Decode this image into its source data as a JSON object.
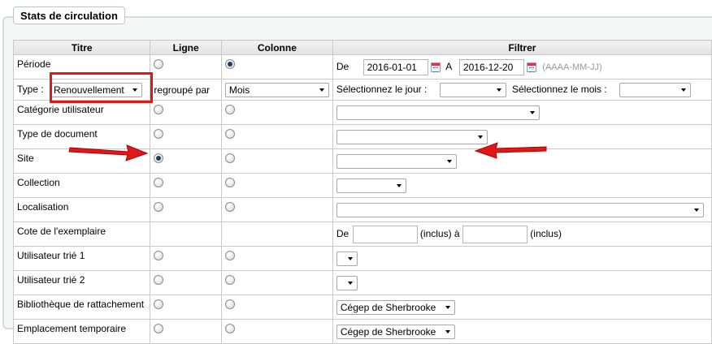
{
  "panel": {
    "title": "Stats de circulation"
  },
  "headers": {
    "titre": "Titre",
    "ligne": "Ligne",
    "colonne": "Colonne",
    "filtrer": "Filtrer"
  },
  "periode": {
    "label": "Période",
    "de_label": "De",
    "de_value": "2016-01-01",
    "a_label": "A",
    "a_value": "2016-12-20",
    "format_hint": "(AAAA-MM-JJ)"
  },
  "type_row": {
    "label": "Type :",
    "type_value": "Renouvellement",
    "grouped_label": "regroupé par",
    "group_value": "Mois",
    "day_label": "Sélectionnez le jour :",
    "month_label": "Sélectionnez le mois :"
  },
  "rows": [
    {
      "label": "Catégorie utilisateur"
    },
    {
      "label": "Type de document"
    },
    {
      "label": "Site"
    },
    {
      "label": "Collection"
    },
    {
      "label": "Localisation"
    },
    {
      "label": "Cote de l'exemplaire",
      "de_label": "De",
      "inclus_a": "(inclus) à",
      "inclus": "(inclus)"
    },
    {
      "label": "Utilisateur trié 1"
    },
    {
      "label": "Utilisateur trié 2"
    },
    {
      "label": "Bibliothèque de rattachement",
      "value": "Cégep de Sherbrooke"
    },
    {
      "label": "Emplacement temporaire",
      "value": "Cégep de Sherbrooke"
    }
  ],
  "colors": {
    "annotation": "#e01818",
    "fieldset_border": "#cfe1d6",
    "radio_dot": "#1a3d6b"
  }
}
